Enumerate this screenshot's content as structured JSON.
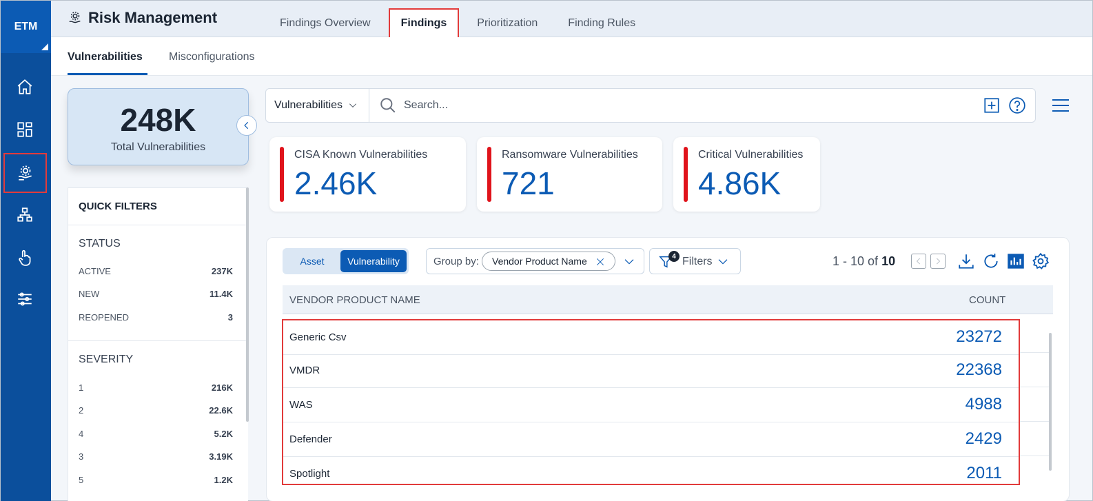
{
  "rail": {
    "logo": "ETM",
    "items": [
      {
        "icon": "home-icon"
      },
      {
        "icon": "dashboard-icon"
      },
      {
        "icon": "risk-management-icon",
        "active": true
      },
      {
        "icon": "assets-icon"
      },
      {
        "icon": "responses-icon"
      },
      {
        "icon": "settings-sliders-icon"
      }
    ]
  },
  "header": {
    "title": "Risk Management",
    "tabs": [
      {
        "label": "Findings Overview"
      },
      {
        "label": "Findings",
        "active": true
      },
      {
        "label": "Prioritization"
      },
      {
        "label": "Finding Rules"
      }
    ]
  },
  "subtabs": [
    {
      "label": "Vulnerabilities",
      "active": true
    },
    {
      "label": "Misconfigurations"
    }
  ],
  "total": {
    "value": "248K",
    "label": "Total Vulnerabilities"
  },
  "quick_filters": {
    "title": "QUICK FILTERS",
    "sections": [
      {
        "title": "STATUS",
        "rows": [
          {
            "label": "ACTIVE",
            "count": "237K"
          },
          {
            "label": "NEW",
            "count": "11.4K"
          },
          {
            "label": "REOPENED",
            "count": "3"
          }
        ]
      },
      {
        "title": "SEVERITY",
        "rows": [
          {
            "label": "1",
            "count": "216K"
          },
          {
            "label": "2",
            "count": "22.6K"
          },
          {
            "label": "4",
            "count": "5.2K"
          },
          {
            "label": "3",
            "count": "3.19K"
          },
          {
            "label": "5",
            "count": "1.2K"
          }
        ]
      }
    ]
  },
  "search": {
    "scope": "Vulnerabilities",
    "placeholder": "Search..."
  },
  "kpis": [
    {
      "label": "CISA Known Vulnerabilities",
      "value": "2.46K"
    },
    {
      "label": "Ransomware Vulnerabilities",
      "value": "721"
    },
    {
      "label": "Critical Vulnerabilities",
      "value": "4.86K"
    }
  ],
  "colors": {
    "accent": "#0c5bb4",
    "kpi_bar": "#e0131b",
    "highlight": "#e23b3b"
  },
  "table": {
    "toggle": [
      {
        "label": "Asset"
      },
      {
        "label": "Vulnerability",
        "selected": true
      }
    ],
    "group_by_label": "Group by:",
    "group_by_value": "Vendor Product Name",
    "filters_label": "Filters",
    "filters_count": "4",
    "pager_range": "1 - 10 of",
    "pager_total": "10",
    "columns": [
      "VENDOR PRODUCT NAME",
      "COUNT"
    ],
    "rows": [
      {
        "name": "Generic Csv",
        "count": "23272"
      },
      {
        "name": "VMDR",
        "count": "22368"
      },
      {
        "name": "WAS",
        "count": "4988"
      },
      {
        "name": "Defender",
        "count": "2429"
      },
      {
        "name": "Spotlight",
        "count": "2011"
      }
    ]
  }
}
